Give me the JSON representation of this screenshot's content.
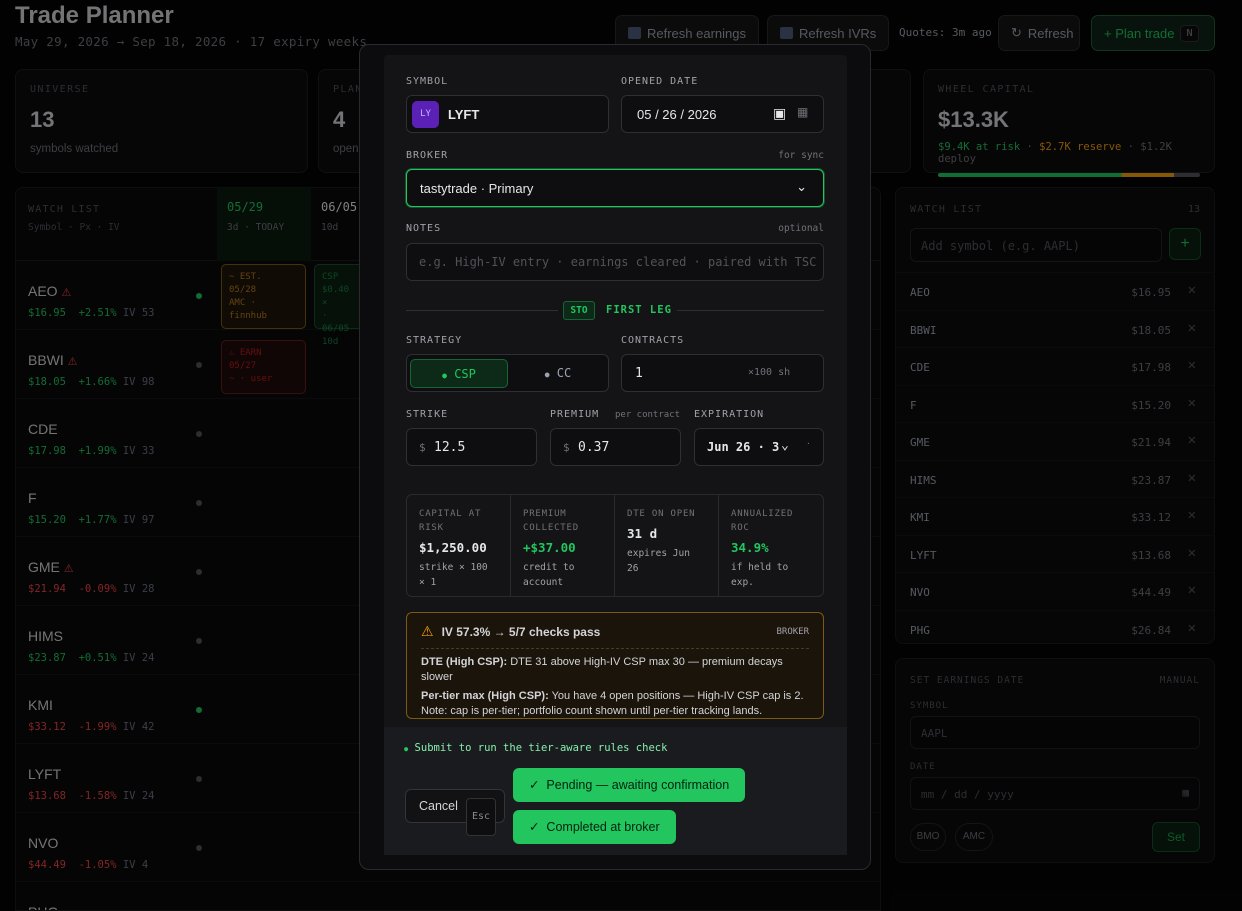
{
  "header": {
    "title": "Trade Planner",
    "subtitle": "May 29, 2026 → Sep 18, 2026 · 17 expiry weeks",
    "refresh_earnings": "Refresh earnings",
    "refresh_ivrs": "Refresh IVRs",
    "quotes": "Quotes: 3m ago",
    "refresh": "Refresh",
    "plan_trade": "+ Plan trade",
    "plan_key": "N"
  },
  "stats": {
    "universe": {
      "label": "UNIVERSE",
      "value": "13",
      "sub": "symbols watched"
    },
    "planned": {
      "label": "PLAN",
      "value": "4",
      "sub": "open"
    },
    "capital": {
      "label": "WHEEL CAPITAL",
      "value": "$13.3K",
      "at_risk": "$9.4K at risk",
      "reserve": "$2.7K reserve",
      "deploy": "$1.2K deploy"
    }
  },
  "grid": {
    "label": "WATCH LIST",
    "sub": "Symbol · Px · IV",
    "columns": [
      {
        "date": "05/29",
        "sub": "3d · TODAY"
      },
      {
        "date": "06/05",
        "sub": "10d"
      }
    ],
    "rows": [
      {
        "sym": "AEO",
        "warn": "⚠",
        "px": "$16.95",
        "chg": "+2.51%",
        "iv": "IV 53",
        "up": true
      },
      {
        "sym": "BBWI",
        "warn": "⚠",
        "px": "$18.05",
        "chg": "+1.66%",
        "iv": "IV 98",
        "up": true
      },
      {
        "sym": "CDE",
        "warn": "",
        "px": "$17.98",
        "chg": "+1.99%",
        "iv": "IV 33",
        "up": true
      },
      {
        "sym": "F",
        "warn": "",
        "px": "$15.20",
        "chg": "+1.77%",
        "iv": "IV 97",
        "up": true
      },
      {
        "sym": "GME",
        "warn": "⚠",
        "px": "$21.94",
        "chg": "-0.09%",
        "iv": "IV 28",
        "up": false
      },
      {
        "sym": "HIMS",
        "warn": "",
        "px": "$23.87",
        "chg": "+0.51%",
        "iv": "IV 24",
        "up": true
      },
      {
        "sym": "KMI",
        "warn": "",
        "px": "$33.12",
        "chg": "-1.99%",
        "iv": "IV 42",
        "up": false
      },
      {
        "sym": "LYFT",
        "warn": "",
        "px": "$13.68",
        "chg": "-1.58%",
        "iv": "IV 24",
        "up": false
      },
      {
        "sym": "NVO",
        "warn": "",
        "px": "$44.49",
        "chg": "-1.05%",
        "iv": "IV 4",
        "up": false
      },
      {
        "sym": "PHG",
        "warn": "",
        "px": "",
        "chg": "",
        "iv": "",
        "up": true
      }
    ],
    "tiles": {
      "est": [
        "~ EST.",
        "05/28",
        "AMC ·",
        "finnhub"
      ],
      "csp": [
        "CSP",
        "$0.40 ×",
        "· 06/05",
        "10d"
      ],
      "earn": [
        "⚠ EARN",
        "05/27",
        "~ · user"
      ]
    }
  },
  "watchlist": {
    "title": "WATCH LIST",
    "count": "13",
    "placeholder": "Add symbol (e.g. AAPL)",
    "add": "+",
    "items": [
      {
        "s": "AEO",
        "p": "$16.95"
      },
      {
        "s": "BBWI",
        "p": "$18.05"
      },
      {
        "s": "CDE",
        "p": "$17.98"
      },
      {
        "s": "F",
        "p": "$15.20"
      },
      {
        "s": "GME",
        "p": "$21.94"
      },
      {
        "s": "HIMS",
        "p": "$23.87"
      },
      {
        "s": "KMI",
        "p": "$33.12"
      },
      {
        "s": "LYFT",
        "p": "$13.68"
      },
      {
        "s": "NVO",
        "p": "$44.49"
      },
      {
        "s": "PHG",
        "p": "$26.84"
      }
    ],
    "remove": "✕"
  },
  "earnings": {
    "title": "SET EARNINGS DATE",
    "mode": "MANUAL",
    "symbol_label": "SYMBOL",
    "symbol_ph": "AAPL",
    "date_label": "DATE",
    "date_ph": "mm / dd / yyyy",
    "bmo": "BMO",
    "amc": "AMC",
    "set": "Set"
  },
  "modal": {
    "symbol_label": "SYMBOL",
    "symbol_badge": "LY",
    "symbol": "LYFT",
    "opened_label": "OPENED DATE",
    "opened": "05 / 26 / 2026",
    "broker_label": "BROKER",
    "broker_hint": "for sync",
    "broker": "tastytrade · Primary",
    "notes_label": "NOTES",
    "notes_hint": "optional",
    "notes_ph": "e.g. High-IV entry · earnings cleared · paired with TSC",
    "leg_tag": "STO",
    "leg_label": "FIRST LEG",
    "strategy_label": "STRATEGY",
    "strategy_csp": "CSP",
    "strategy_cc": "CC",
    "contracts_label": "CONTRACTS",
    "contracts": "1",
    "contracts_unit": "×100 sh",
    "strike_label": "STRIKE",
    "strike": "12.5",
    "premium_label": "PREMIUM",
    "premium_hint": "per contract",
    "premium": "0.37",
    "exp_label": "EXPIRATION",
    "exp": "Jun 26 · 3",
    "currency": "$",
    "metrics": [
      {
        "k": "CAPITAL AT RISK",
        "v": "$1,250.00",
        "n": "strike × 100 × 1",
        "c": "w"
      },
      {
        "k": "PREMIUM COLLECTED",
        "v": "+$37.00",
        "n": "credit to account",
        "c": "g"
      },
      {
        "k": "DTE ON OPEN",
        "v": "31 d",
        "n": "expires Jun 26",
        "c": "w"
      },
      {
        "k": "ANNUALIZED ROC",
        "v": "34.9%",
        "n": "if held to exp.",
        "c": "g"
      }
    ],
    "warn_title": "IV 57.3% → 5/7 checks pass",
    "warn_tag": "BROKER",
    "warn1_b": "DTE (High CSP):",
    "warn1": " DTE 31 above High-IV CSP max 30 — premium decays slower",
    "warn2_b": "Per-tier max (High CSP):",
    "warn2": " You have 4 open positions — High-IV CSP cap is 2. Note: cap is per-tier; portfolio count shown until per-tier tracking lands.",
    "submit_hint": "Submit to run the tier-aware rules check",
    "cancel": "Cancel",
    "esc": "Esc",
    "pending": "Pending — awaiting confirmation",
    "completed": "Completed at broker"
  }
}
